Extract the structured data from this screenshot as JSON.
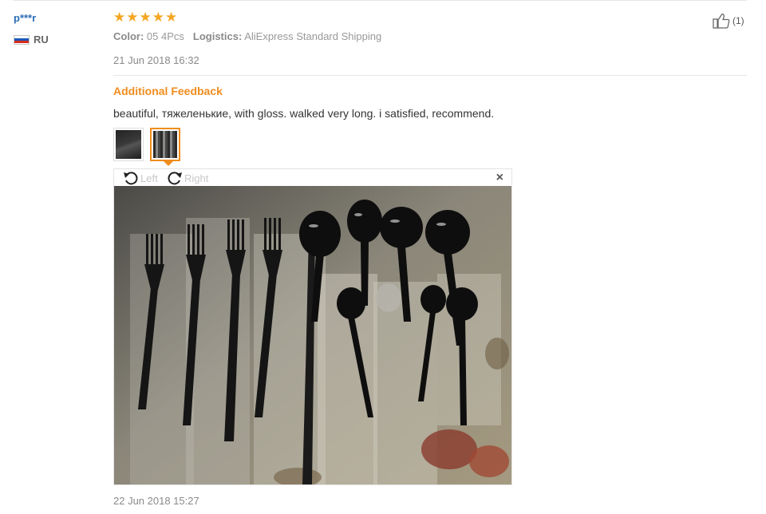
{
  "review": {
    "user": "p***r",
    "country": "RU",
    "rating_stars": 5,
    "color_label": "Color:",
    "color_value": "05 4Pcs",
    "logistics_label": "Logistics:",
    "logistics_value": "AliExpress Standard Shipping",
    "date": "21 Jun 2018 16:32",
    "likes": "(1)",
    "additional_title": "Additional Feedback",
    "feedback_text": "beautiful, тяжеленькие, with gloss. walked very long. i satisfied, recommend.",
    "viewer": {
      "rotate_left": "Left",
      "rotate_right": "Right",
      "close": "×"
    },
    "additional_date": "22 Jun 2018 15:27"
  },
  "colors": {
    "accent": "#f08c1e",
    "star": "#f5a623",
    "username": "#2d6db5"
  },
  "icons": [
    "flag-ru-icon",
    "star-icon",
    "thumbs-up-icon",
    "rotate-left-icon",
    "rotate-right-icon",
    "close-icon"
  ]
}
